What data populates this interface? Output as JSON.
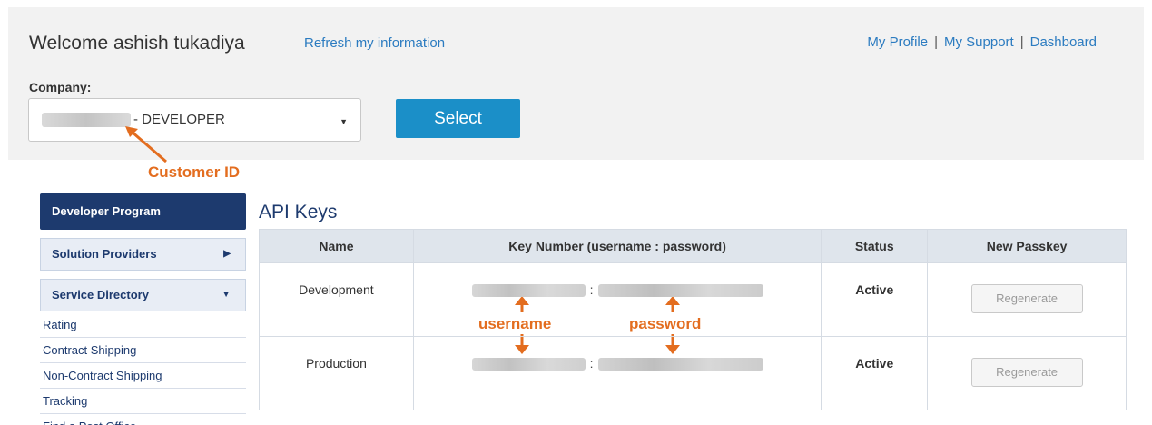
{
  "header": {
    "welcome": "Welcome ashish tukadiya",
    "refresh_link": "Refresh my information",
    "links": [
      "My Profile",
      "My Support",
      "Dashboard"
    ],
    "separator": "|"
  },
  "company": {
    "label": "Company:",
    "selected_suffix": "- DEVELOPER",
    "caret_icon": "caret-down-icon",
    "select_button": "Select"
  },
  "annotations": {
    "customer_id": "Customer ID",
    "username": "username",
    "password": "password",
    "color": "#e36d1f"
  },
  "sidebar": {
    "header": "Developer Program",
    "items": [
      {
        "label": "Solution Providers",
        "icon": "chevron-right-icon"
      },
      {
        "label": "Service Directory",
        "icon": "chevron-down-icon"
      }
    ],
    "sub_items": [
      "Rating",
      "Contract Shipping",
      "Non-Contract Shipping",
      "Tracking",
      "Find a Post Office"
    ]
  },
  "api_keys": {
    "title": "API Keys",
    "columns": [
      "Name",
      "Key Number (username : password)",
      "Status",
      "New Passkey"
    ],
    "rows": [
      {
        "name": "Development",
        "separator": ":",
        "status": "Active",
        "action": "Regenerate"
      },
      {
        "name": "Production",
        "separator": ":",
        "status": "Active",
        "action": "Regenerate"
      }
    ]
  },
  "colors": {
    "brand_navy": "#1d3a6e",
    "link_blue": "#2b7bc0",
    "select_button": "#1b8fc8",
    "status_active": "#5aa826",
    "annotation": "#e36d1f"
  }
}
